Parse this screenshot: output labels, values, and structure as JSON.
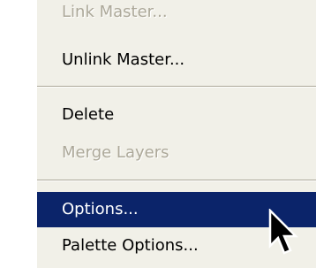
{
  "menu": {
    "items": [
      {
        "label": "Link Master...",
        "enabled": false
      },
      {
        "label": "Unlink Master...",
        "enabled": true
      },
      {
        "label": "Delete",
        "enabled": true
      },
      {
        "label": "Merge Layers",
        "enabled": false
      },
      {
        "label": "Options...",
        "enabled": true,
        "selected": true
      },
      {
        "label": "Palette Options...",
        "enabled": true
      }
    ]
  },
  "cursor": {
    "icon": "arrow-pointer-icon"
  },
  "colors": {
    "menu_background": "#f1f0e8",
    "highlight": "#0b246a",
    "disabled_text": "#aca899"
  }
}
